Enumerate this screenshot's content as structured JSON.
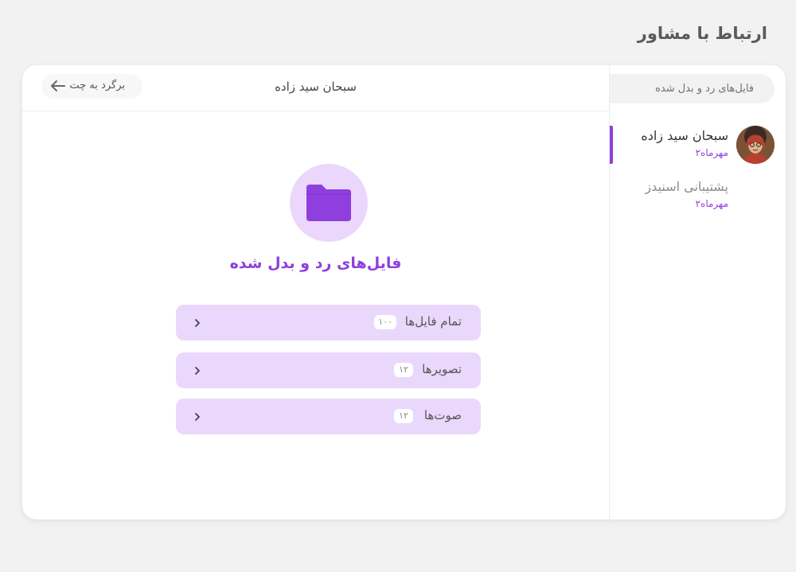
{
  "page": {
    "title": "ارتباط با مشاور"
  },
  "sidebar": {
    "search_text": "فایل‌های رد و بدل شده",
    "contacts": [
      {
        "name": "سبحان سید زاده",
        "date": "مهرماه۲",
        "active": true
      },
      {
        "name": "پشتیبانی اسنیدز",
        "date": "مهرماه۲",
        "active": false
      }
    ]
  },
  "header": {
    "name": "سبحان سید زاده",
    "back_label": "برگرد به چت"
  },
  "files": {
    "title": "فایل‌های رد و بدل شده",
    "categories": [
      {
        "label": "تمام فایل‌ها",
        "count": "۱۰۰"
      },
      {
        "label": "تصویرها",
        "count": "۱۲"
      },
      {
        "label": "صوت‌ها",
        "count": "۱۲"
      }
    ]
  },
  "colors": {
    "accent": "#8e3fde",
    "row_bg": "#e9d8fb",
    "folder_bg": "#ead7fb",
    "page_bg": "#f2f2f3"
  },
  "icons": [
    "arrow-left-icon",
    "folder-icon",
    "chevron-right-icon",
    "avatar-photo"
  ]
}
